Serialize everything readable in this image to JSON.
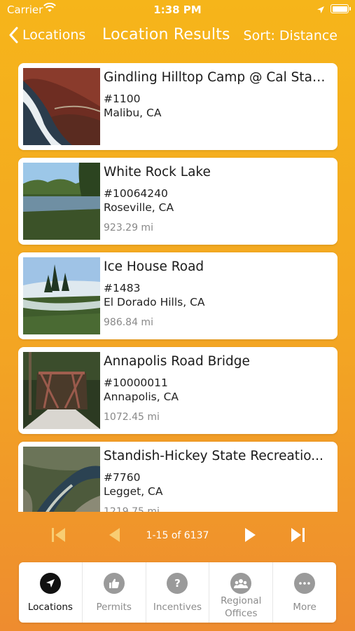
{
  "status": {
    "carrier": "Carrier",
    "time": "1:38 PM"
  },
  "nav": {
    "back_label": "Locations",
    "title": "Location Results",
    "sort_label": "Sort: Distance"
  },
  "results": [
    {
      "name": "Gindling Hilltop Camp @ Cal Stat...",
      "number": "#1100",
      "city": "Malibu, CA",
      "distance": ""
    },
    {
      "name": "White Rock Lake",
      "number": "#10064240",
      "city": "Roseville, CA",
      "distance": "923.29 mi"
    },
    {
      "name": "Ice House Road",
      "number": "#1483",
      "city": "El Dorado Hills, CA",
      "distance": "986.84 mi"
    },
    {
      "name": "Annapolis Road Bridge",
      "number": "#10000011",
      "city": "Annapolis, CA",
      "distance": "1072.45 mi"
    },
    {
      "name": "Standish-Hickey State Recreatio...",
      "number": "#7760",
      "city": "Legget, CA",
      "distance": "1219.75 mi"
    }
  ],
  "pager": {
    "range": "1-15 of 6137"
  },
  "tabs": [
    {
      "label": "Locations",
      "icon": "location-arrow-icon",
      "active": true
    },
    {
      "label": "Permits",
      "icon": "thumbs-up-icon",
      "active": false
    },
    {
      "label": "Incentives",
      "icon": "question-icon",
      "active": false
    },
    {
      "label": "Regional Offices",
      "icon": "group-icon",
      "active": false
    },
    {
      "label": "More",
      "icon": "ellipsis-icon",
      "active": false
    }
  ],
  "colors": {
    "background_top": "#f6b51a",
    "background_bottom": "#ee8c2f",
    "active_tab": "#111111",
    "inactive_tab": "#9a9a9a"
  }
}
